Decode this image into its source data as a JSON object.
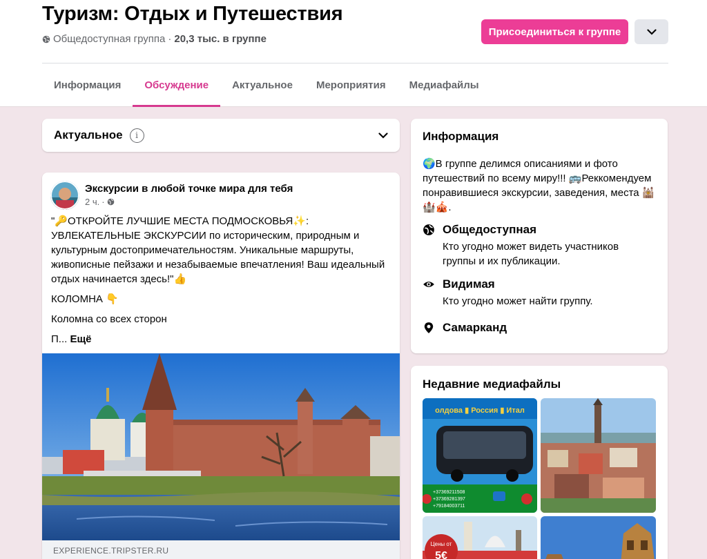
{
  "group": {
    "title": "Туризм: Отдых и Путешествия",
    "privacy": "Общедоступная группа",
    "separator": "·",
    "members": "20,3 тыс. в группе",
    "join_label": "Присоединиться к группе"
  },
  "tabs": [
    {
      "label": "Информация"
    },
    {
      "label": "Обсуждение"
    },
    {
      "label": "Актуальное"
    },
    {
      "label": "Мероприятия"
    },
    {
      "label": "Медиафайлы"
    }
  ],
  "active_tab": "Обсуждение",
  "trending": {
    "title": "Актуальное",
    "info_glyph": "i"
  },
  "post": {
    "author": "Экскурсии в любой точке мира для тебя",
    "time": "2 ч.",
    "time_sep": "·",
    "paragraphs": [
      "\"🔑ОТКРОЙТЕ ЛУЧШИЕ МЕСТА ПОДМОСКОВЬЯ✨: УВЛЕКАТЕЛЬНЫЕ ЭКСКУРСИИ по историческим, природным и культурным достопримечательностям. Уникальные маршруты, живописные пейзажи и незабываемые впечатления! Ваш идеальный отдых начинается здесь!\"👍",
      "КОЛОМНА 👇",
      "Коломна со всех сторон"
    ],
    "truncated": "П...",
    "more": "Ещё",
    "link_domain": "EXPERIENCE.TRIPSTER.RU"
  },
  "info": {
    "title": "Информация",
    "description": "🌍В группе делимся описаниями и фото путешествий по всему миру!!! 🚌Реккомендуем понравившиеся экскурсии, заведения, места 🕍🏰🎪.",
    "public_title": "Общедоступная",
    "public_desc": "Кто угодно может видеть участников группы и их публикации.",
    "visible_title": "Видимая",
    "visible_desc": "Кто угодно может найти группу.",
    "location": "Самарканд"
  },
  "media": {
    "title": "Недавние медиафайлы",
    "thumb1_caption": "олдова ▮ Россия ▮ Итал",
    "thumb1_phones": [
      "+37369211508",
      "+37369281397",
      "+79184003711"
    ],
    "thumb3_price_label": "Цены от",
    "thumb3_price": "5€"
  },
  "colors": {
    "accent": "#d6398f",
    "join_button": "#ec3d96",
    "background": "#f2e5ea"
  }
}
